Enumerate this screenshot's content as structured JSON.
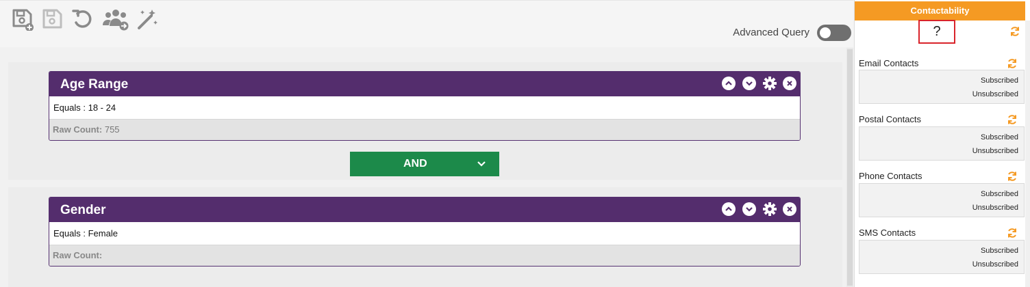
{
  "toolbar": {
    "icons": [
      "save-add-icon",
      "save-icon",
      "undo-icon",
      "users-transfer-icon",
      "magic-wand-icon"
    ],
    "advanced_query_label": "Advanced Query"
  },
  "blocks": [
    {
      "title": "Age Range",
      "condition": "Equals : 18 - 24",
      "raw_label": "Raw Count:",
      "raw_value": "755"
    },
    {
      "title": "Gender",
      "condition": "Equals : Female",
      "raw_label": "Raw Count:",
      "raw_value": ""
    }
  ],
  "operator": {
    "label": "AND"
  },
  "contactability": {
    "title": "Contactability",
    "summary": "?",
    "sections": [
      {
        "title": "Email Contacts",
        "subscribed": "Subscribed",
        "unsubscribed": "Unsubscribed"
      },
      {
        "title": "Postal Contacts",
        "subscribed": "Subscribed",
        "unsubscribed": "Unsubscribed"
      },
      {
        "title": "Phone Contacts",
        "subscribed": "Subscribed",
        "unsubscribed": "Unsubscribed"
      },
      {
        "title": "SMS Contacts",
        "subscribed": "Subscribed",
        "unsubscribed": "Unsubscribed"
      }
    ]
  },
  "colors": {
    "block_header": "#542d6d",
    "operator": "#1c8a4a",
    "panel_header": "#f59a23",
    "refresh": "#f59a23",
    "highlight": "#d9232a"
  }
}
